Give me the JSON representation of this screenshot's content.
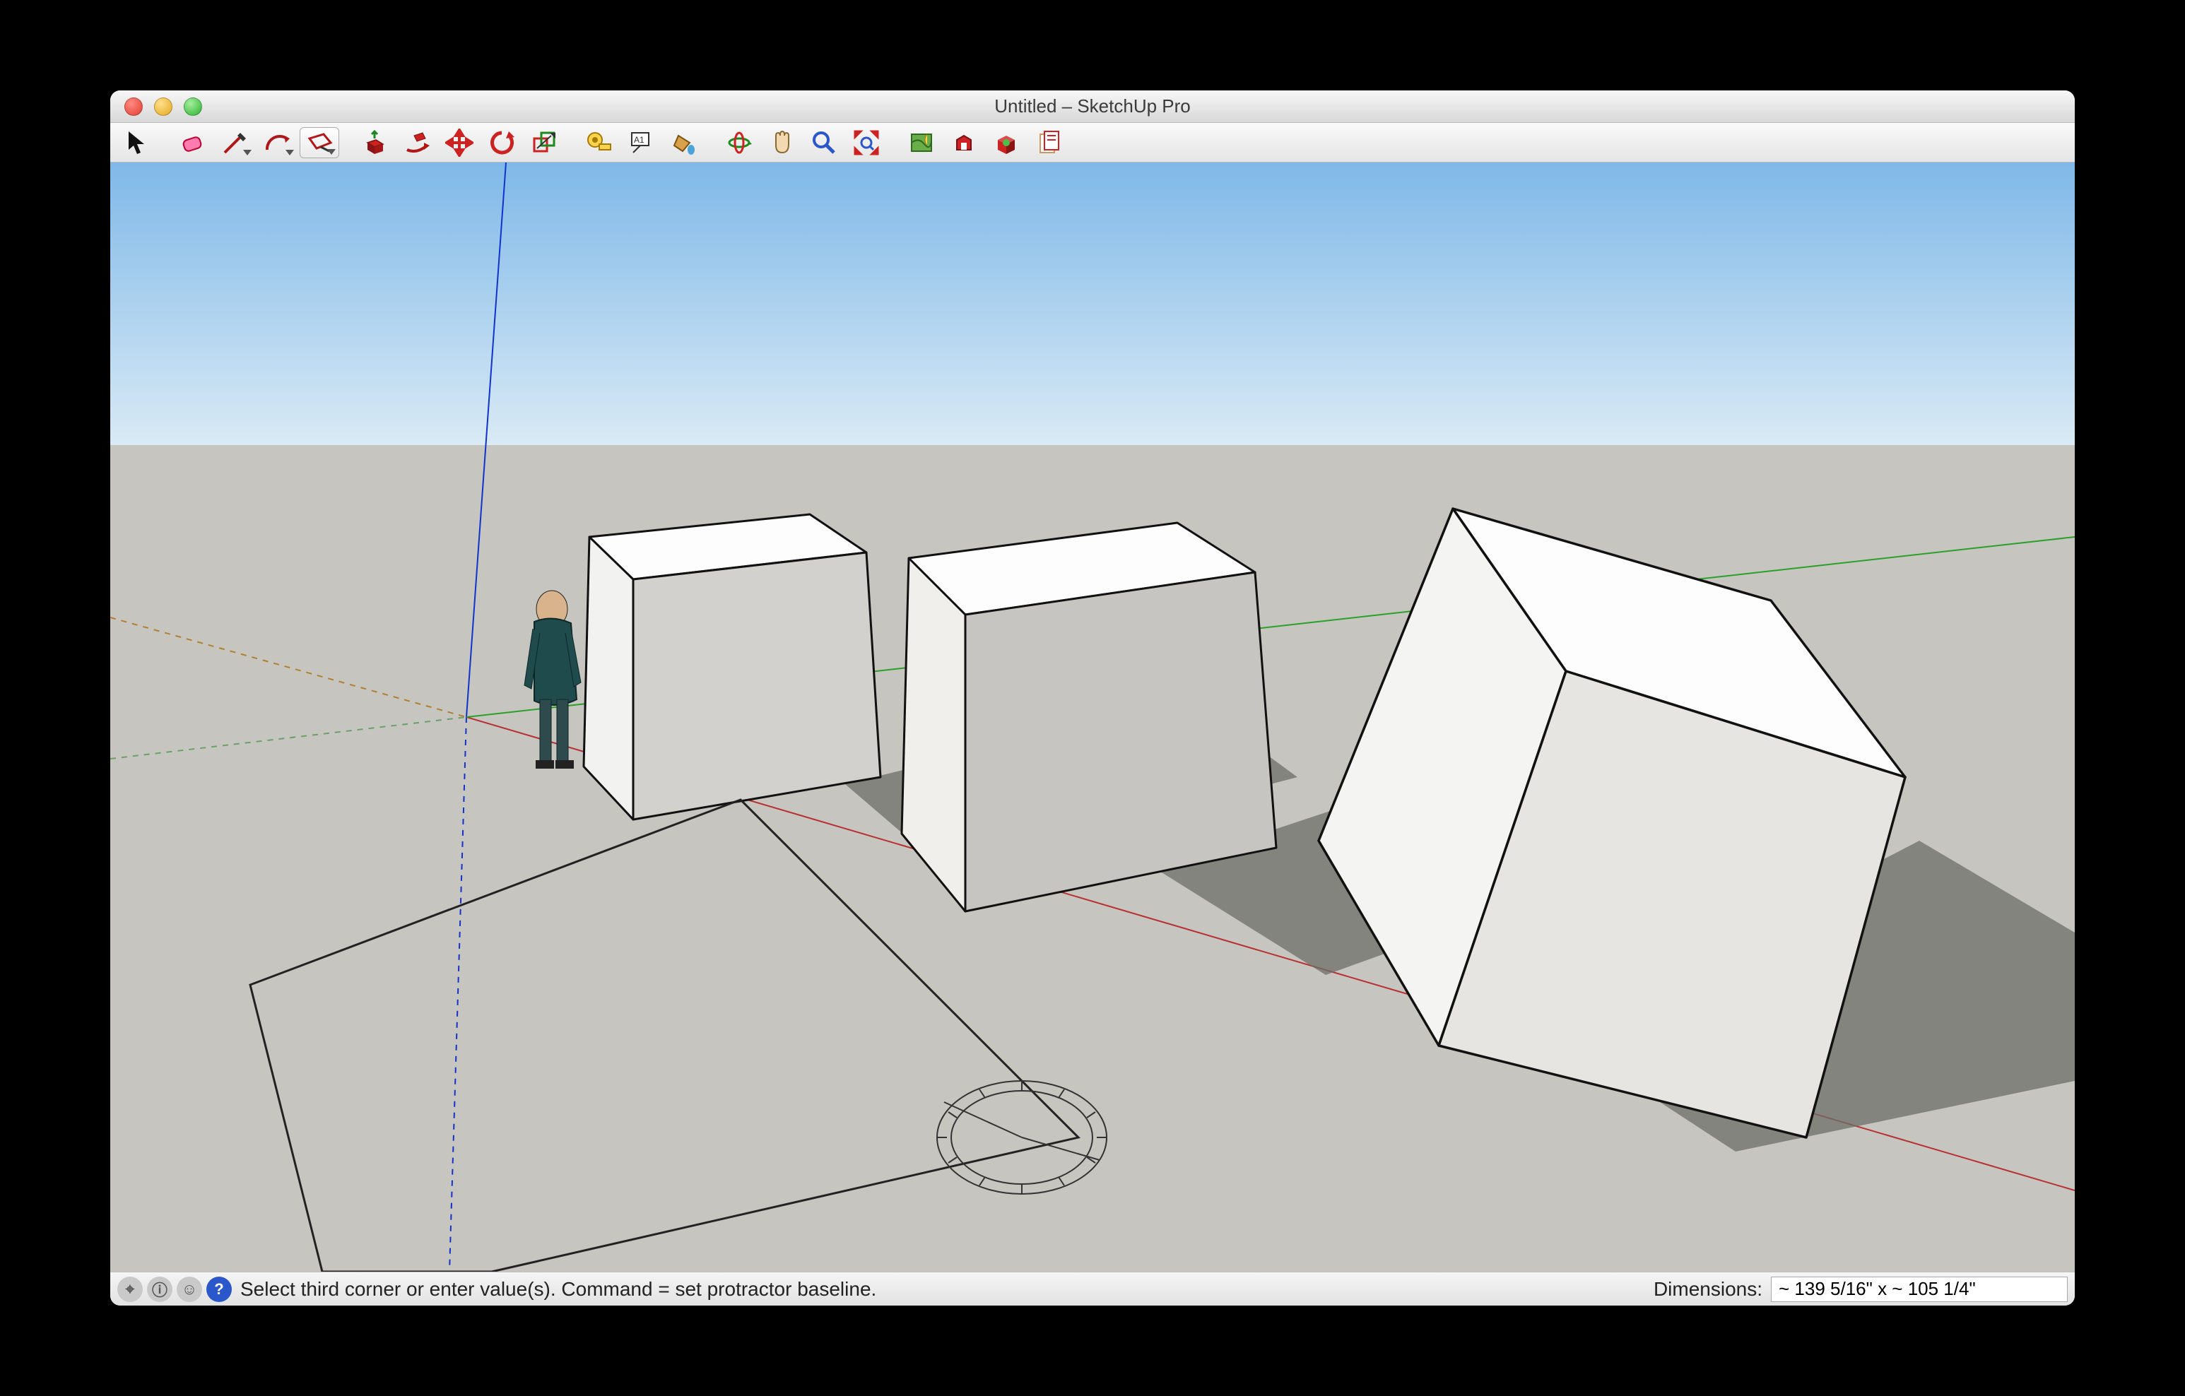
{
  "window": {
    "title": "Untitled – SketchUp Pro"
  },
  "toolbar": {
    "tools": [
      {
        "name": "select",
        "dropdown": false
      },
      {
        "name": "eraser",
        "dropdown": false
      },
      {
        "name": "line",
        "dropdown": true
      },
      {
        "name": "arc",
        "dropdown": true
      },
      {
        "name": "rectangle",
        "dropdown": true
      },
      {
        "name": "push-pull",
        "dropdown": false
      },
      {
        "name": "follow-me",
        "dropdown": false
      },
      {
        "name": "move",
        "dropdown": false
      },
      {
        "name": "rotate",
        "dropdown": false,
        "active": true
      },
      {
        "name": "scale",
        "dropdown": false
      },
      {
        "name": "tape-measure",
        "dropdown": false
      },
      {
        "name": "text",
        "dropdown": false
      },
      {
        "name": "paint-bucket",
        "dropdown": false
      },
      {
        "name": "orbit",
        "dropdown": false
      },
      {
        "name": "pan",
        "dropdown": false
      },
      {
        "name": "zoom",
        "dropdown": false
      },
      {
        "name": "zoom-extents",
        "dropdown": false
      },
      {
        "name": "add-location",
        "dropdown": false
      },
      {
        "name": "3d-warehouse",
        "dropdown": false
      },
      {
        "name": "extension-warehouse",
        "dropdown": false
      },
      {
        "name": "layout",
        "dropdown": false
      }
    ]
  },
  "status": {
    "hint": "Select third corner or enter value(s). Command = set protractor baseline.",
    "dimensions_label": "Dimensions:",
    "dimensions_value": "~ 139 5/16\" x ~ 105 1/4\""
  }
}
